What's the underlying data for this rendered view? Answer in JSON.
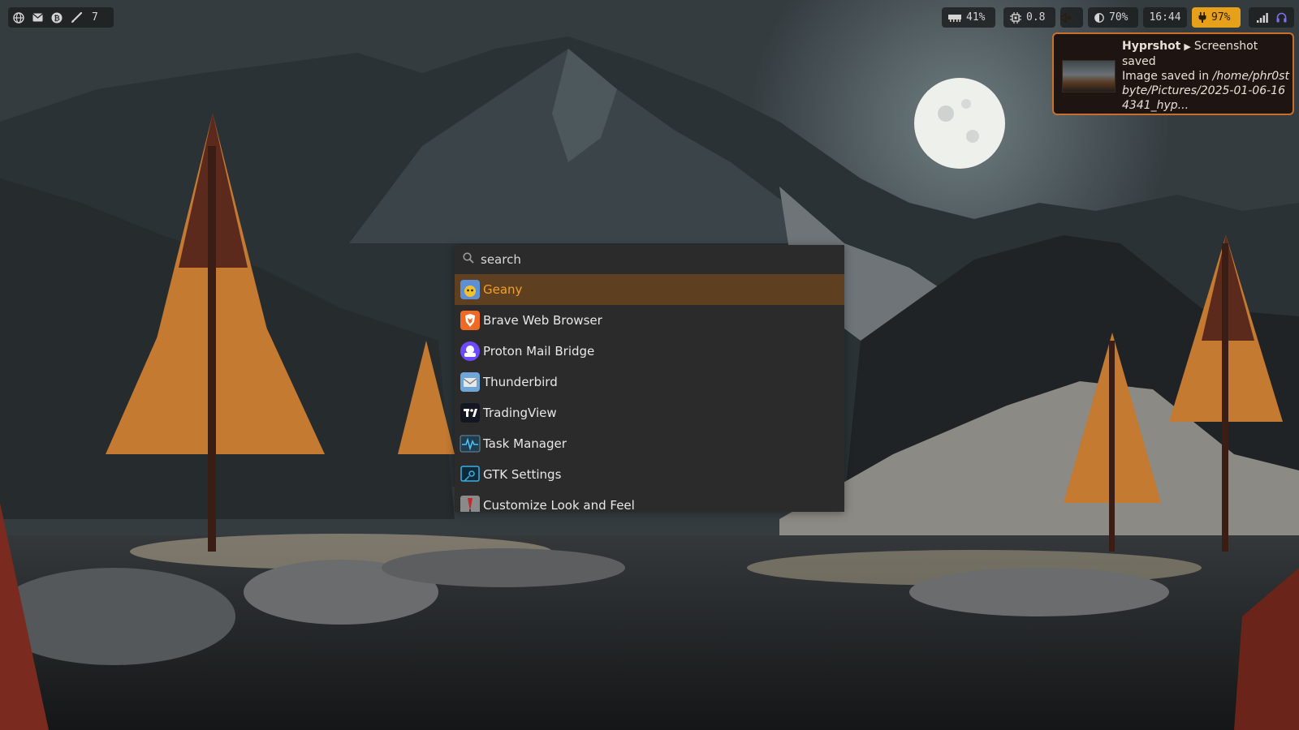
{
  "topbar": {
    "workspace_count": "7",
    "memory": "41%",
    "cpu_load": "0.8",
    "brightness": "70%",
    "clock": "16:44",
    "battery": "97%",
    "icons": [
      "globe-icon",
      "mail-icon",
      "bitcoin-icon",
      "brush-icon",
      "memory-icon",
      "cpu-icon",
      "volume-muted-icon",
      "brightness-icon",
      "battery-charging-icon",
      "signal-icon",
      "headphones-icon"
    ]
  },
  "notification": {
    "app": "Hyprshot",
    "summary": "Screenshot saved",
    "body_prefix": "Image saved in ",
    "body_path": "/home/phr0stbyte/Pictures/2025-01-06-164341_hyp..."
  },
  "launcher": {
    "search_placeholder": "search",
    "apps": [
      {
        "label": "Geany",
        "icon": "geany-icon"
      },
      {
        "label": "Brave Web Browser",
        "icon": "brave-icon"
      },
      {
        "label": "Proton Mail Bridge",
        "icon": "proton-mail-bridge-icon"
      },
      {
        "label": "Thunderbird",
        "icon": "thunderbird-icon"
      },
      {
        "label": "TradingView",
        "icon": "tradingview-icon"
      },
      {
        "label": "Task Manager",
        "icon": "task-manager-icon"
      },
      {
        "label": "GTK Settings",
        "icon": "gtk-settings-icon"
      },
      {
        "label": "Customize Look and Feel",
        "icon": "customize-look-icon"
      }
    ],
    "selected_index": 0
  },
  "colors": {
    "accent": "#e6a019",
    "selection_bg": "#5e4020",
    "selection_text": "#f0a030",
    "notification_border": "#c96f2a"
  }
}
